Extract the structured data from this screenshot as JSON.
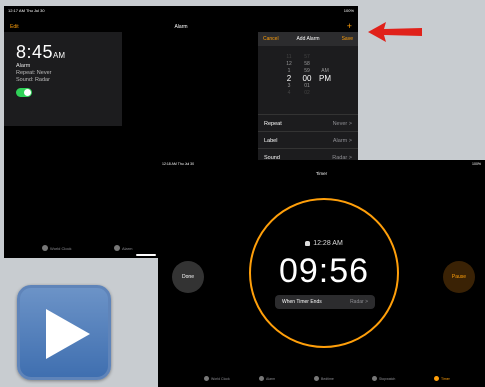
{
  "alarm_app": {
    "status_left": "12:17 AM  Thu Jul 30",
    "status_right": "100%",
    "edit_label": "Edit",
    "title": "Alarm",
    "add_label": "+",
    "alarm_item": {
      "time": "8:45",
      "ampm": "AM",
      "label": "Alarm",
      "repeat": "Repeat: Never",
      "sound": "Sound: Radar",
      "enabled": true
    },
    "add_sheet": {
      "cancel_label": "Cancel",
      "title": "Add Alarm",
      "save_label": "Save",
      "picker": {
        "hours": [
          "11",
          "12",
          "1",
          "2",
          "3",
          "4"
        ],
        "minutes": [
          "57",
          "58",
          "59",
          "00",
          "01",
          "02",
          "03"
        ],
        "ampm": [
          "AM",
          "PM"
        ],
        "selected_hour": "2",
        "selected_minute": "00",
        "selected_ampm": "PM"
      },
      "rows": [
        {
          "label": "Repeat",
          "value": "Never >"
        },
        {
          "label": "Label",
          "value": "Alarm >"
        },
        {
          "label": "Sound",
          "value": "Radar >"
        }
      ]
    },
    "tabs": [
      {
        "label": "World Clock"
      },
      {
        "label": "Alarm"
      }
    ]
  },
  "timer_app": {
    "status_left": "12:18 AM  Thu Jul 30",
    "status_right": "100%",
    "title": "Timer",
    "done_label": "Done",
    "pause_label": "Pause",
    "alarm_at": "12:28 AM",
    "countdown": "09:56",
    "when_ends_label": "When Timer Ends",
    "when_ends_value": "Radar >",
    "tabs": [
      {
        "label": "World Clock"
      },
      {
        "label": "Alarm"
      },
      {
        "label": "Bedtime"
      },
      {
        "label": "Stopwatch"
      },
      {
        "label": "Timer"
      }
    ]
  },
  "colors": {
    "accent_orange": "#ff9f0a",
    "toggle_green": "#30d158",
    "arrow_red": "#e0211a",
    "play_blue": "#4f7fbf"
  }
}
